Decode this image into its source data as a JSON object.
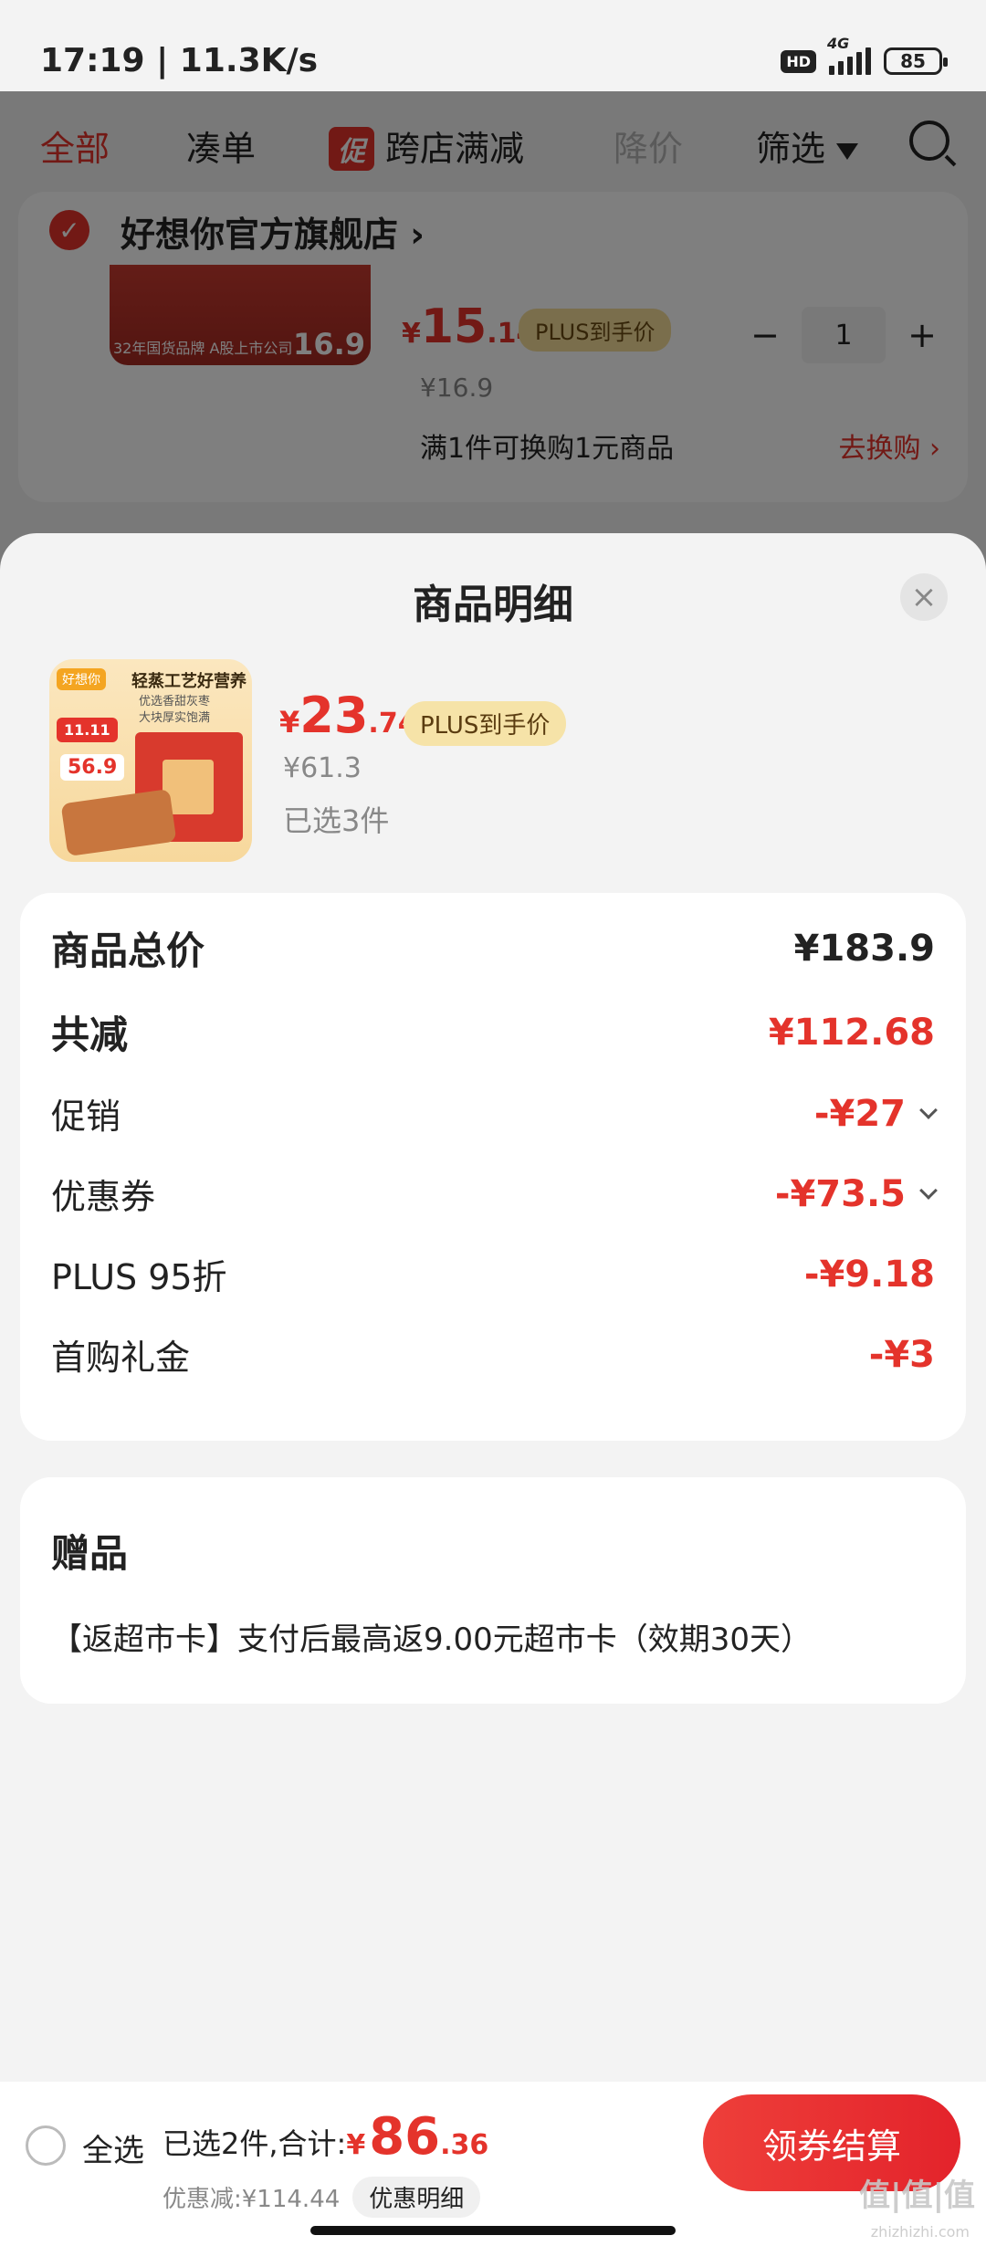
{
  "status_bar": {
    "time_speed": "17:19 | 11.3K/s",
    "hd": "HD",
    "network": "4G",
    "battery": "85"
  },
  "tabs": [
    {
      "label": "全部"
    },
    {
      "label": "凑单"
    },
    {
      "label": "跨店满减",
      "badge": "促"
    },
    {
      "label": "降价"
    },
    {
      "label": "筛选"
    }
  ],
  "store": {
    "name": "好想你官方旗舰店",
    "thumb_caption": "32年国货品牌 A股上市公司",
    "thumb_price": "16.9",
    "price_yen": "¥",
    "price_int": "15",
    "price_dec": ".14",
    "plus_label": "PLUS到手价",
    "orig_price": "¥16.9",
    "quantity": "1",
    "swap_text": "满1件可换购1元商品",
    "swap_link": "去换购"
  },
  "sheet": {
    "title": "商品明细",
    "product": {
      "thumb_brand": "好想你",
      "thumb_slogan": "轻蒸工艺好营养",
      "thumb_sub1": "优选香甜灰枣",
      "thumb_sub2": "大块厚实饱满",
      "thumb_tag": "11.11",
      "thumb_price": "56.9",
      "price_yen": "¥",
      "price_int": "23",
      "price_dec": ".74",
      "plus_label": "PLUS到手价",
      "orig_price": "¥61.3",
      "selected": "已选3件"
    },
    "summary": {
      "total_label": "商品总价",
      "total_value": "¥183.9",
      "reduce_label": "共减",
      "reduce_value": "¥112.68",
      "items": [
        {
          "label": "促销",
          "value": "-¥27",
          "expandable": true
        },
        {
          "label": "优惠券",
          "value": "-¥73.5",
          "expandable": true
        },
        {
          "label": "PLUS 95折",
          "value": "-¥9.18",
          "expandable": false
        },
        {
          "label": "首购礼金",
          "value": "-¥3",
          "expandable": false
        }
      ]
    },
    "gift": {
      "title": "赠品",
      "text": "【返超市卡】支付后最高返9.00元超市卡（效期30天）"
    }
  },
  "bottom_bar": {
    "select_all": "全选",
    "selected_total_label": "已选2件,合计:",
    "total_yen": "¥",
    "total_int": "86",
    "total_dec": ".36",
    "discount": "优惠减:¥114.44",
    "detail_button": "优惠明细",
    "checkout_button": "领券结算"
  },
  "watermark": {
    "text": "值|值|值",
    "sub": "zhizhizhi.com"
  },
  "colors": {
    "accent": "#e4332b",
    "plus_badge": "#f6e3a8",
    "background": "#f3f3f3"
  }
}
